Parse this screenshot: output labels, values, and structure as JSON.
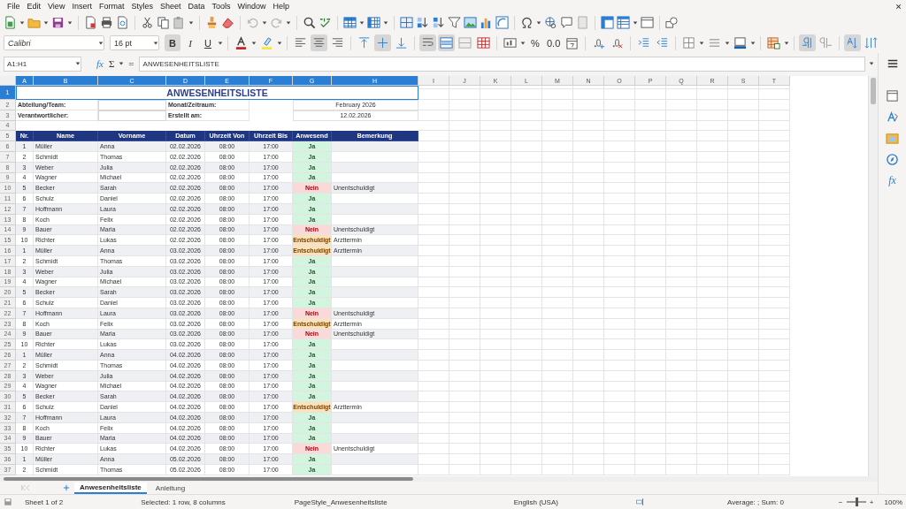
{
  "menu": [
    "File",
    "Edit",
    "View",
    "Insert",
    "Format",
    "Styles",
    "Sheet",
    "Data",
    "Tools",
    "Window",
    "Help"
  ],
  "format_toolbar": {
    "font_name": "Calibri",
    "font_size": "16 pt",
    "buttons": [
      {
        "kind": "bold",
        "label": "B",
        "selected": true
      },
      {
        "kind": "italic",
        "label": "I",
        "selected": false
      },
      {
        "kind": "underline",
        "label": "U",
        "selected": false
      },
      {
        "kind": "font-color"
      },
      {
        "kind": "highlight"
      },
      {
        "kind": "align-left",
        "selected": false
      },
      {
        "kind": "align-center",
        "selected": true
      },
      {
        "kind": "align-right",
        "selected": false
      },
      {
        "kind": "align-top",
        "selected": false
      },
      {
        "kind": "align-middle",
        "selected": true
      },
      {
        "kind": "align-bottom",
        "selected": false
      },
      {
        "kind": "wrap-text",
        "selected": true
      },
      {
        "kind": "merge-center",
        "selected": true
      },
      {
        "kind": "merge-cells",
        "selected": false
      },
      {
        "kind": "unmerge-cells",
        "selected": false
      },
      {
        "kind": "number-format"
      },
      {
        "kind": "percent",
        "label": "%"
      },
      {
        "kind": "decimal",
        "label": "0.0"
      },
      {
        "kind": "date"
      },
      {
        "kind": "add-decimal"
      },
      {
        "kind": "delete-decimal"
      },
      {
        "kind": "indent"
      },
      {
        "kind": "outdent"
      },
      {
        "kind": "borders"
      },
      {
        "kind": "border-style"
      },
      {
        "kind": "border-color"
      },
      {
        "kind": "conditional"
      },
      {
        "kind": "left-to-right",
        "selected": true
      },
      {
        "kind": "right-to-left",
        "selected": false
      },
      {
        "kind": "text-horizontal",
        "selected": true
      },
      {
        "kind": "text-vertical",
        "selected": false
      }
    ]
  },
  "formula_bar": {
    "cell_reference": "A1:H1",
    "function_wizard": "fx",
    "sum": "Σ",
    "formula": "=",
    "content": "ANWESENHEITSLISTE"
  },
  "sheet": {
    "columns": [
      {
        "label": "A",
        "selected": true
      },
      {
        "label": "B",
        "selected": true
      },
      {
        "label": "C",
        "selected": true
      },
      {
        "label": "D",
        "selected": true
      },
      {
        "label": "E",
        "selected": true
      },
      {
        "label": "F",
        "selected": true
      },
      {
        "label": "G",
        "selected": true
      },
      {
        "label": "H",
        "selected": true
      },
      {
        "label": "I",
        "selected": false
      },
      {
        "label": "J",
        "selected": false
      },
      {
        "label": "K",
        "selected": false
      },
      {
        "label": "L",
        "selected": false
      },
      {
        "label": "M",
        "selected": false
      },
      {
        "label": "N",
        "selected": false
      },
      {
        "label": "O",
        "selected": false
      },
      {
        "label": "P",
        "selected": false
      },
      {
        "label": "Q",
        "selected": false
      },
      {
        "label": "R",
        "selected": false
      },
      {
        "label": "S",
        "selected": false
      },
      {
        "label": "T",
        "selected": false
      }
    ],
    "title": {
      "row": "1",
      "selected": true,
      "text": "ANWESENHEITSLISTE"
    },
    "info_rows": [
      {
        "row": "2",
        "selected": false,
        "label": "Abteilung/Team:",
        "label_2": "Monat/Zeitraum:",
        "value_2": "February 2026"
      },
      {
        "row": "3",
        "selected": false,
        "label": "Verantwortlicher:",
        "label_2": "Erstellt am:",
        "value_2": "12.02.2026"
      }
    ],
    "empty_row": {
      "row": "4",
      "selected": false
    },
    "table": {
      "row": "5",
      "selected": false,
      "columns": [
        "Nr.",
        "Name",
        "Vorname",
        "Datum",
        "Uhrzeit Von",
        "Uhrzeit Bis",
        "Anwesend",
        "Bemerkung"
      ],
      "rows": [
        {
          "row": "6",
          "selected": false,
          "kind": "present",
          "cells": [
            "1",
            "Müller",
            "Anna",
            "02.02.2026",
            "08:00",
            "17:00",
            "Ja"
          ]
        },
        {
          "row": "7",
          "selected": false,
          "kind": "present",
          "cells": [
            "2",
            "Schmidt",
            "Thomas",
            "02.02.2026",
            "08:00",
            "17:00",
            "Ja"
          ]
        },
        {
          "row": "8",
          "selected": false,
          "kind": "present",
          "cells": [
            "3",
            "Weber",
            "Julia",
            "02.02.2026",
            "08:00",
            "17:00",
            "Ja"
          ]
        },
        {
          "row": "9",
          "selected": false,
          "kind": "present",
          "cells": [
            "4",
            "Wagner",
            "Michael",
            "02.02.2026",
            "08:00",
            "17:00",
            "Ja"
          ]
        },
        {
          "row": "10",
          "selected": false,
          "kind": "absent",
          "cells": [
            "5",
            "Becker",
            "Sarah",
            "02.02.2026",
            "08:00",
            "17:00",
            "Nein"
          ],
          "remark": "Unentschuldigt"
        },
        {
          "row": "11",
          "selected": false,
          "kind": "present",
          "cells": [
            "6",
            "Schulz",
            "Daniel",
            "02.02.2026",
            "08:00",
            "17:00",
            "Ja"
          ]
        },
        {
          "row": "12",
          "selected": false,
          "kind": "present",
          "cells": [
            "7",
            "Hoffmann",
            "Laura",
            "02.02.2026",
            "08:00",
            "17:00",
            "Ja"
          ]
        },
        {
          "row": "13",
          "selected": false,
          "kind": "present",
          "cells": [
            "8",
            "Koch",
            "Felix",
            "02.02.2026",
            "08:00",
            "17:00",
            "Ja"
          ]
        },
        {
          "row": "14",
          "selected": false,
          "kind": "absent",
          "cells": [
            "9",
            "Bauer",
            "Maria",
            "02.02.2026",
            "08:00",
            "17:00",
            "Nein"
          ],
          "remark": "Unentschuldigt"
        },
        {
          "row": "15",
          "selected": false,
          "kind": "excused",
          "cells": [
            "10",
            "Richter",
            "Lukas",
            "02.02.2026",
            "08:00",
            "17:00",
            "Entschuldigt"
          ],
          "remark": "Arzttermin"
        },
        {
          "row": "16",
          "selected": false,
          "kind": "excused",
          "cells": [
            "1",
            "Müller",
            "Anna",
            "03.02.2026",
            "08:00",
            "17:00",
            "Entschuldigt"
          ],
          "remark": "Arzttermin"
        },
        {
          "row": "17",
          "selected": false,
          "kind": "present",
          "cells": [
            "2",
            "Schmidt",
            "Thomas",
            "03.02.2026",
            "08:00",
            "17:00",
            "Ja"
          ]
        },
        {
          "row": "18",
          "selected": false,
          "kind": "present",
          "cells": [
            "3",
            "Weber",
            "Julia",
            "03.02.2026",
            "08:00",
            "17:00",
            "Ja"
          ]
        },
        {
          "row": "19",
          "selected": false,
          "kind": "present",
          "cells": [
            "4",
            "Wagner",
            "Michael",
            "03.02.2026",
            "08:00",
            "17:00",
            "Ja"
          ]
        },
        {
          "row": "20",
          "selected": false,
          "kind": "present",
          "cells": [
            "5",
            "Becker",
            "Sarah",
            "03.02.2026",
            "08:00",
            "17:00",
            "Ja"
          ]
        },
        {
          "row": "21",
          "selected": false,
          "kind": "present",
          "cells": [
            "6",
            "Schulz",
            "Daniel",
            "03.02.2026",
            "08:00",
            "17:00",
            "Ja"
          ]
        },
        {
          "row": "22",
          "selected": false,
          "kind": "absent",
          "cells": [
            "7",
            "Hoffmann",
            "Laura",
            "03.02.2026",
            "08:00",
            "17:00",
            "Nein"
          ],
          "remark": "Unentschuldigt"
        },
        {
          "row": "23",
          "selected": false,
          "kind": "excused",
          "cells": [
            "8",
            "Koch",
            "Felix",
            "03.02.2026",
            "08:00",
            "17:00",
            "Entschuldigt"
          ],
          "remark": "Arzttermin"
        },
        {
          "row": "24",
          "selected": false,
          "kind": "absent",
          "cells": [
            "9",
            "Bauer",
            "Maria",
            "03.02.2026",
            "08:00",
            "17:00",
            "Nein"
          ],
          "remark": "Unentschuldigt"
        },
        {
          "row": "25",
          "selected": false,
          "kind": "present",
          "cells": [
            "10",
            "Richter",
            "Lukas",
            "03.02.2026",
            "08:00",
            "17:00",
            "Ja"
          ]
        },
        {
          "row": "26",
          "selected": false,
          "kind": "present",
          "cells": [
            "1",
            "Müller",
            "Anna",
            "04.02.2026",
            "08:00",
            "17:00",
            "Ja"
          ]
        },
        {
          "row": "27",
          "selected": false,
          "kind": "present",
          "cells": [
            "2",
            "Schmidt",
            "Thomas",
            "04.02.2026",
            "08:00",
            "17:00",
            "Ja"
          ]
        },
        {
          "row": "28",
          "selected": false,
          "kind": "present",
          "cells": [
            "3",
            "Weber",
            "Julia",
            "04.02.2026",
            "08:00",
            "17:00",
            "Ja"
          ]
        },
        {
          "row": "29",
          "selected": false,
          "kind": "present",
          "cells": [
            "4",
            "Wagner",
            "Michael",
            "04.02.2026",
            "08:00",
            "17:00",
            "Ja"
          ]
        },
        {
          "row": "30",
          "selected": false,
          "kind": "present",
          "cells": [
            "5",
            "Becker",
            "Sarah",
            "04.02.2026",
            "08:00",
            "17:00",
            "Ja"
          ]
        },
        {
          "row": "31",
          "selected": false,
          "kind": "excused",
          "cells": [
            "6",
            "Schulz",
            "Daniel",
            "04.02.2026",
            "08:00",
            "17:00",
            "Entschuldigt"
          ],
          "remark": "Arzttermin"
        },
        {
          "row": "32",
          "selected": false,
          "kind": "present",
          "cells": [
            "7",
            "Hoffmann",
            "Laura",
            "04.02.2026",
            "08:00",
            "17:00",
            "Ja"
          ]
        },
        {
          "row": "33",
          "selected": false,
          "kind": "present",
          "cells": [
            "8",
            "Koch",
            "Felix",
            "04.02.2026",
            "08:00",
            "17:00",
            "Ja"
          ]
        },
        {
          "row": "34",
          "selected": false,
          "kind": "present",
          "cells": [
            "9",
            "Bauer",
            "Maria",
            "04.02.2026",
            "08:00",
            "17:00",
            "Ja"
          ]
        },
        {
          "row": "35",
          "selected": false,
          "kind": "absent",
          "cells": [
            "10",
            "Richter",
            "Lukas",
            "04.02.2026",
            "08:00",
            "17:00",
            "Nein"
          ],
          "remark": "Unentschuldigt"
        },
        {
          "row": "36",
          "selected": false,
          "kind": "present",
          "cells": [
            "1",
            "Müller",
            "Anna",
            "05.02.2026",
            "08:00",
            "17:00",
            "Ja"
          ]
        },
        {
          "row": "37",
          "selected": false,
          "kind": "present",
          "cells": [
            "2",
            "Schmidt",
            "Thomas",
            "05.02.2026",
            "08:00",
            "17:00",
            "Ja"
          ]
        }
      ]
    }
  },
  "sheet_tabs": [
    {
      "label": "Anwesenheitsliste",
      "selected": true
    },
    {
      "label": "Anleitung",
      "selected": false
    }
  ],
  "sidebar": {
    "function_label": "fx"
  },
  "status_bar": {
    "sheet": "Sheet 1 of 2",
    "selection": "Selected: 1 row, 8 columns",
    "page_style": "PageStyle_Anwesenheitsliste",
    "language": "English (USA)",
    "summary": "Average: ; Sum: 0",
    "zoom_out": "−",
    "zoom_slider": {
      "level": 0.5
    },
    "zoom_in": "+",
    "zoom": "100%"
  }
}
